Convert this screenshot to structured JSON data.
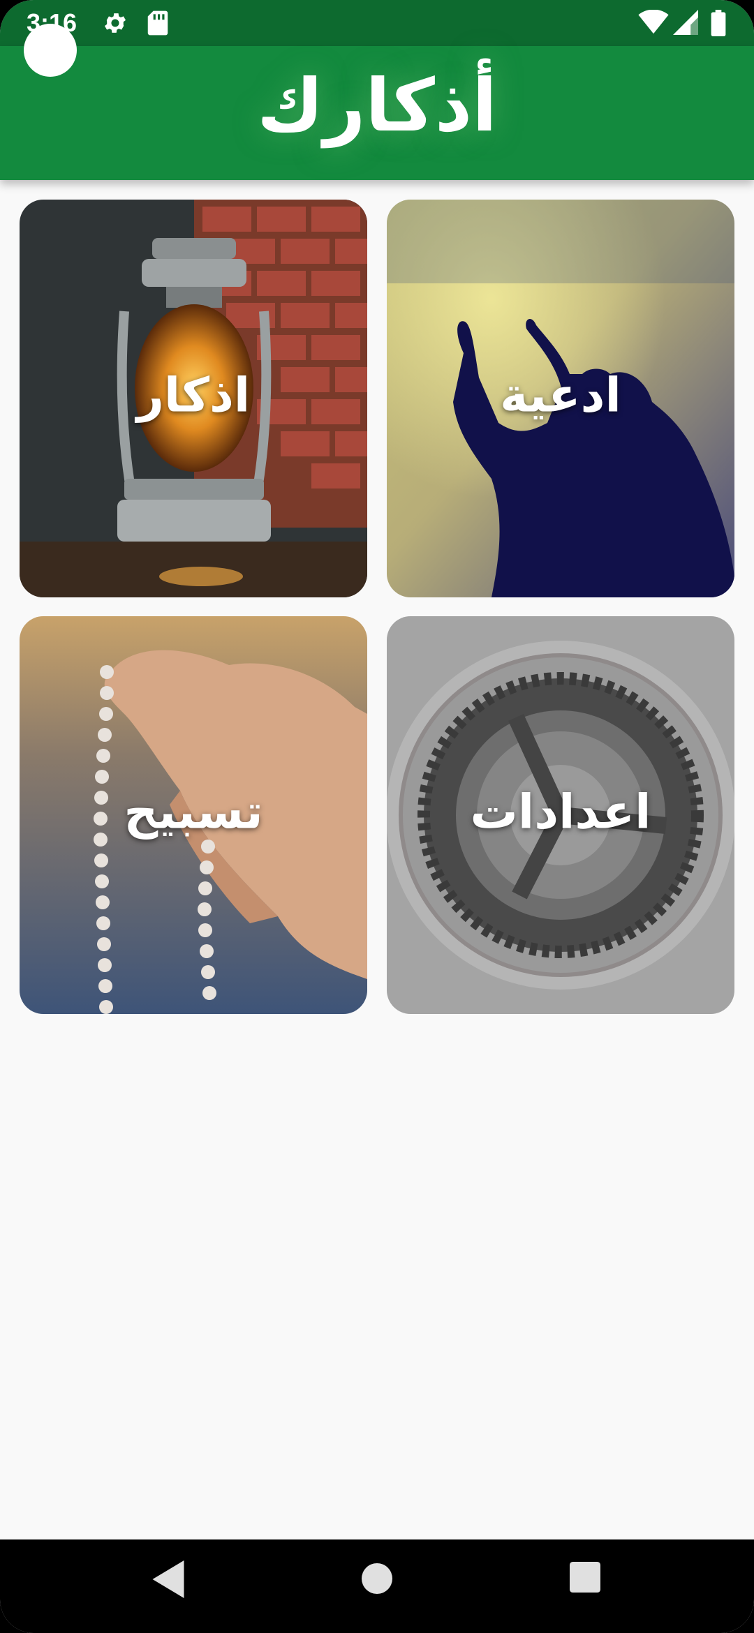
{
  "status_bar": {
    "time": "3:16",
    "icons": [
      "settings-icon",
      "sd-card-icon",
      "wifi-icon",
      "signal-icon",
      "battery-icon"
    ]
  },
  "app_bar": {
    "title": "أذكارك",
    "color": "#138a3e"
  },
  "cards": [
    {
      "label": "ادعية",
      "image": "praying-man-silhouette"
    },
    {
      "label": "اذكار",
      "image": "lantern"
    },
    {
      "label": "اعدادات",
      "image": "gear"
    },
    {
      "label": "تسبيح",
      "image": "prayer-beads-hand"
    }
  ],
  "nav_bar": {
    "buttons": [
      "back-icon",
      "home-icon",
      "recents-icon"
    ]
  }
}
